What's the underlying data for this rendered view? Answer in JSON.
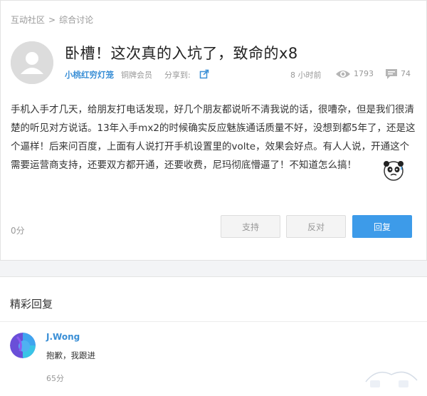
{
  "breadcrumb": {
    "home": "互动社区",
    "separator": ">",
    "section": "综合讨论"
  },
  "post": {
    "title": "卧槽！这次真的入坑了，致命的x8",
    "author": "小桃红穷灯笼",
    "member_level": "铜牌会员",
    "share_label": "分享到:",
    "time": "8 小时前",
    "views": "1793",
    "replies": "74",
    "content": "手机入手才几天，给朋友打电话发现，好几个朋友都说听不清我说的话，很嘈杂，但是我们很清楚的听见对方说话。13年入手mx2的时候确实反应魅族通话质量不好，没想到都5年了，还是这个逼样！后来问百度，上面有人说打开手机设置里的volte，效果会好点。有人人说，开通这个需要运营商支持，还要双方都开通，还要收费，尼玛彻底懵逼了！不知道怎么搞！",
    "score": "0分",
    "buttons": {
      "support": "支持",
      "oppose": "反对",
      "reply": "回复"
    }
  },
  "featured": {
    "title": "精彩回复",
    "replies": [
      {
        "name": "J.Wong",
        "text": "抱歉，我跟进",
        "score": "65分"
      }
    ]
  },
  "icons": {
    "avatar": "default-user-avatar",
    "share": "share-arrow-icon",
    "views": "eye-icon",
    "replies": "comment-icon",
    "emoji": "sweating-panda-emoji"
  },
  "colors": {
    "accent": "#3d9be9",
    "link": "#3a8fd6"
  }
}
